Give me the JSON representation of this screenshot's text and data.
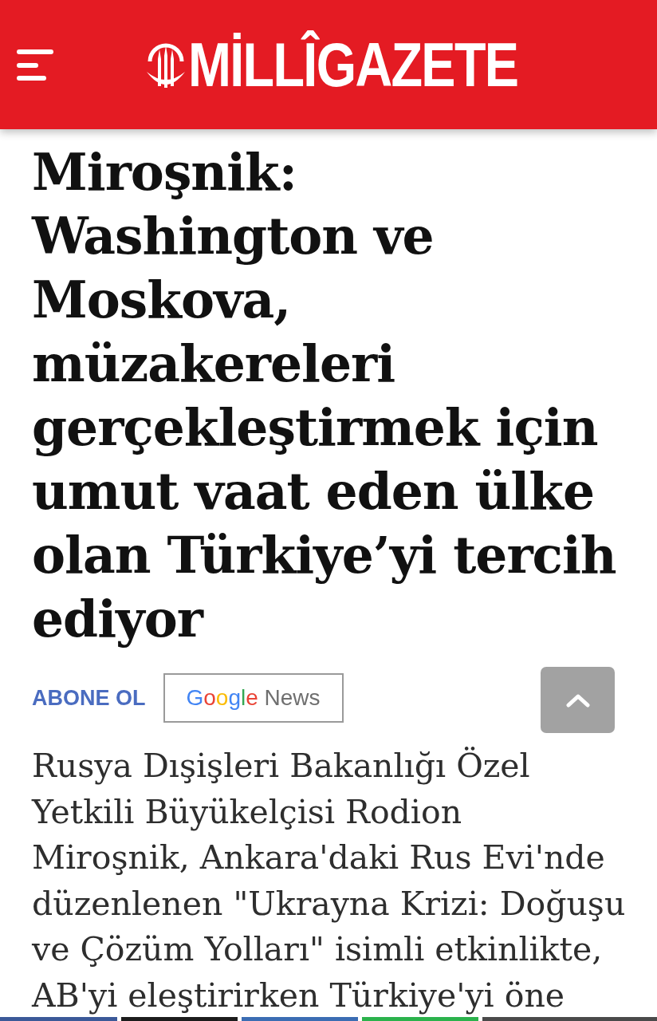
{
  "header": {
    "logo_text": "MİLLÎGAZETE"
  },
  "article": {
    "title_lines": [
      "Miroşnik:",
      "Washington ve",
      "Moskova,",
      "müzakereleri",
      "gerçekleştirmek için",
      "umut vaat eden ülke",
      "olan Türkiye’yi tercih",
      "ediyor"
    ],
    "subscribe": {
      "label": "ABONE OL",
      "button_brand": "Google",
      "button_text": "News"
    },
    "body_lines": [
      "Rusya Dışişleri Bakanlığı Özel",
      "Yetkili Büyükelçisi Rodion",
      "Miroşnik, Ankara'daki Rus Evi'nde",
      "düzenlenen \"Ukrayna Krizi: Doğuşu",
      "ve Çözüm Yolları\" isimli etkinlikte,",
      "AB'yi eleştirirken Türkiye'yi öne"
    ]
  },
  "share_buttons": [
    {
      "color": "#3b5998"
    },
    {
      "color": "#1c1c1c"
    },
    {
      "color": "#3b6db3"
    },
    {
      "color": "#2bb24c"
    },
    {
      "color": "#4a4a4a"
    }
  ]
}
